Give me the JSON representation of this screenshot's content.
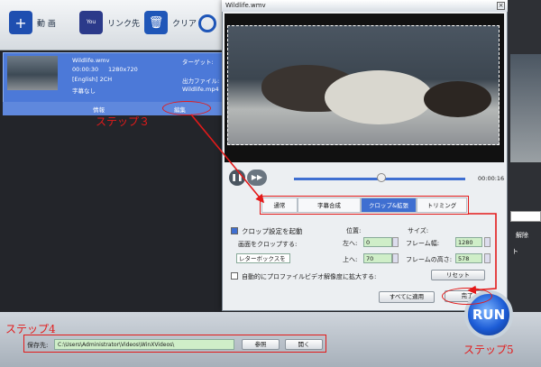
{
  "toolbar": {
    "video_label": "動 画",
    "youtube_label": "リンク先",
    "clear_label": "クリア"
  },
  "file": {
    "name": "Wildlife.wmv",
    "duration": "00:00:30",
    "resolution": "1280x720",
    "audio": "[English] 2CH",
    "subtitle": "字幕なし",
    "target_label": "ターゲット:",
    "output_label": "出力ファイル:",
    "output_name": "Wildlife.mp4",
    "info_label": "情報",
    "edit_label": "編集"
  },
  "dialog": {
    "title": "Wildlife.wmv",
    "time": "00:00:16",
    "tabs": [
      "通常",
      "字幕合成",
      "クロップ&拡張",
      "トリミング"
    ],
    "active_tab": 2,
    "crop_enable": "クロップ設定を起動",
    "position_label": "位置:",
    "size_label": "サイズ:",
    "crop_area_label": "画面をクロップする:",
    "crop_mode": "レターボックスを",
    "left_label": "左へ:",
    "left_value": "0",
    "top_label": "上へ:",
    "top_value": "70",
    "width_label": "フレーム幅:",
    "width_value": "1280",
    "height_label": "フレームの高さ:",
    "height_value": "578",
    "expand_label": "自動的にプロファイルビデオ解像度に拡大する:",
    "reset_label": "リセット",
    "apply_all_label": "すべてに適用",
    "done_label": "完了"
  },
  "bottom": {
    "save_label": "保存先:",
    "save_path": "C:\\Users\\Administrator\\Videos\\WinXVideos\\",
    "browse_label": "参照",
    "open_label": "開く"
  },
  "annotations": {
    "step3": "ステップ３",
    "step4": "ステップ4",
    "step5": "ステップ5"
  },
  "run_label": "RUN",
  "right_labels": {
    "a": "解除",
    "b": "ト"
  },
  "colors": {
    "accent": "#3f6fd1",
    "annotation": "#e31a1a",
    "field": "#cfeec8"
  }
}
